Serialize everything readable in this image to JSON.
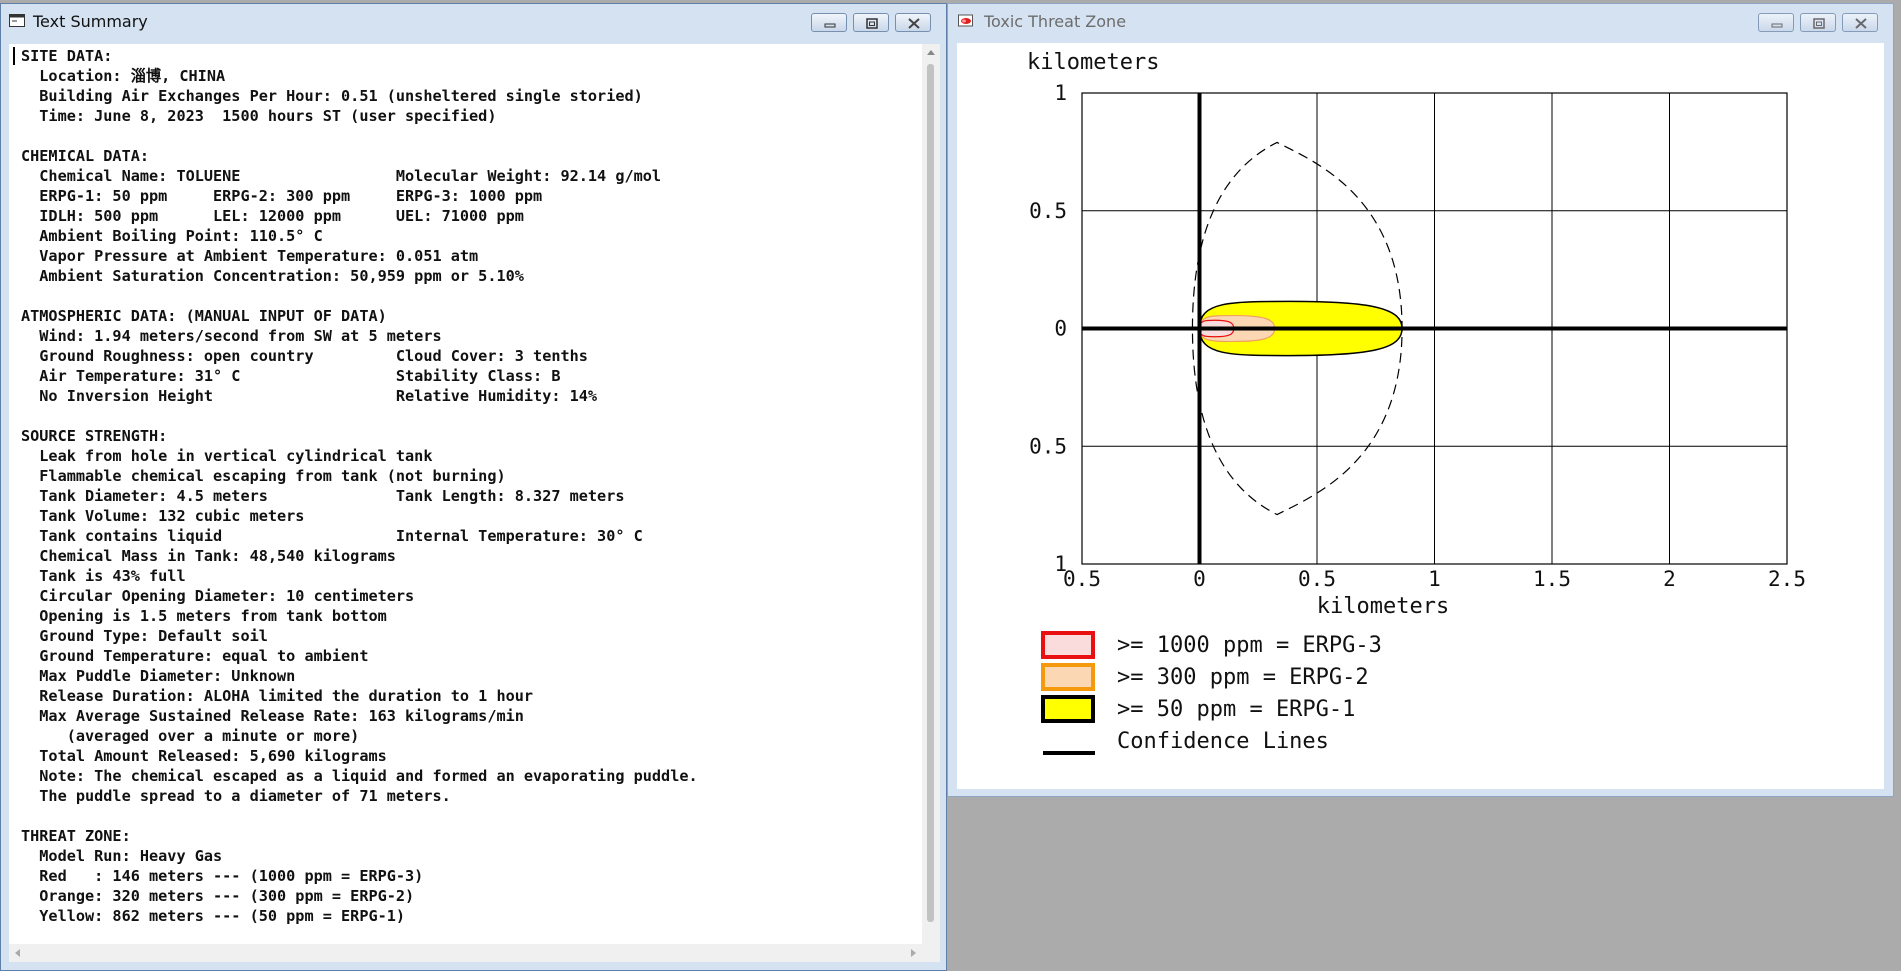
{
  "windows": {
    "text_summary": {
      "title": "Text Summary",
      "lines": [
        "SITE DATA:",
        "  Location: 淄博, CHINA",
        "  Building Air Exchanges Per Hour: 0.51 (unsheltered single storied)",
        "  Time: June 8, 2023  1500 hours ST (user specified)",
        "",
        "CHEMICAL DATA:",
        "  Chemical Name: TOLUENE                 Molecular Weight: 92.14 g/mol",
        "  ERPG-1: 50 ppm     ERPG-2: 300 ppm     ERPG-3: 1000 ppm",
        "  IDLH: 500 ppm      LEL: 12000 ppm      UEL: 71000 ppm",
        "  Ambient Boiling Point: 110.5° C",
        "  Vapor Pressure at Ambient Temperature: 0.051 atm",
        "  Ambient Saturation Concentration: 50,959 ppm or 5.10%",
        "",
        "ATMOSPHERIC DATA: (MANUAL INPUT OF DATA)",
        "  Wind: 1.94 meters/second from SW at 5 meters",
        "  Ground Roughness: open country         Cloud Cover: 3 tenths",
        "  Air Temperature: 31° C                 Stability Class: B",
        "  No Inversion Height                    Relative Humidity: 14%",
        "",
        "SOURCE STRENGTH:",
        "  Leak from hole in vertical cylindrical tank",
        "  Flammable chemical escaping from tank (not burning)",
        "  Tank Diameter: 4.5 meters              Tank Length: 8.327 meters",
        "  Tank Volume: 132 cubic meters",
        "  Tank contains liquid                   Internal Temperature: 30° C",
        "  Chemical Mass in Tank: 48,540 kilograms",
        "  Tank is 43% full",
        "  Circular Opening Diameter: 10 centimeters",
        "  Opening is 1.5 meters from tank bottom",
        "  Ground Type: Default soil",
        "  Ground Temperature: equal to ambient",
        "  Max Puddle Diameter: Unknown",
        "  Release Duration: ALOHA limited the duration to 1 hour",
        "  Max Average Sustained Release Rate: 163 kilograms/min",
        "     (averaged over a minute or more)",
        "  Total Amount Released: 5,690 kilograms",
        "  Note: The chemical escaped as a liquid and formed an evaporating puddle.",
        "  The puddle spread to a diameter of 71 meters.",
        "",
        "THREAT ZONE:",
        "  Model Run: Heavy Gas",
        "  Red   : 146 meters --- (1000 ppm = ERPG-3)",
        "  Orange: 320 meters --- (300 ppm = ERPG-2)",
        "  Yellow: 862 meters --- (50 ppm = ERPG-1)"
      ]
    },
    "threat_zone": {
      "title": "Toxic Threat Zone",
      "y_unit_label": "kilometers",
      "x_unit_label": "kilometers",
      "legend": [
        {
          "label": ">= 1000 ppm = ERPG-3",
          "fill": "#fadcdc",
          "stroke": "#e81010"
        },
        {
          "label": ">= 300 ppm = ERPG-2",
          "fill": "#fbd8b3",
          "stroke": "#f59a0c"
        },
        {
          "label": ">= 50 ppm = ERPG-1",
          "fill": "#ffff00",
          "stroke": "#000000"
        },
        {
          "label": "Confidence Lines",
          "fill": "none",
          "stroke": "#000000"
        }
      ]
    }
  },
  "chart_data": {
    "type": "area",
    "xlim": [
      -0.5,
      2.5
    ],
    "ylim": [
      -1,
      1
    ],
    "x_ticks": [
      -0.5,
      0,
      0.5,
      1,
      1.5,
      2,
      2.5
    ],
    "x_tick_labels": [
      "0.5",
      "0",
      "0.5",
      "1",
      "1.5",
      "2",
      "2.5"
    ],
    "y_ticks": [
      1,
      0.5,
      0,
      -0.5,
      -1
    ],
    "y_tick_labels": [
      "1",
      "0.5",
      "0",
      "0.5",
      "1"
    ],
    "xlabel": "kilometers",
    "ylabel": "kilometers",
    "grid": true,
    "series": [
      {
        "name": ">= 50 ppm = ERPG-1",
        "x_start": 0,
        "x_end": 0.862,
        "half_width": 0.115,
        "color": "#ffff00"
      },
      {
        "name": ">= 300 ppm = ERPG-2",
        "x_start": 0,
        "x_end": 0.32,
        "half_width": 0.055,
        "color": "#fbd8b3"
      },
      {
        "name": ">= 1000 ppm = ERPG-3",
        "x_start": 0,
        "x_end": 0.146,
        "half_width": 0.035,
        "color": "#fadcdc"
      }
    ],
    "confidence_lines": {
      "x_min": -0.03,
      "x_max": 0.862,
      "apex_x": 0.33,
      "apex_y": 0.79
    }
  }
}
